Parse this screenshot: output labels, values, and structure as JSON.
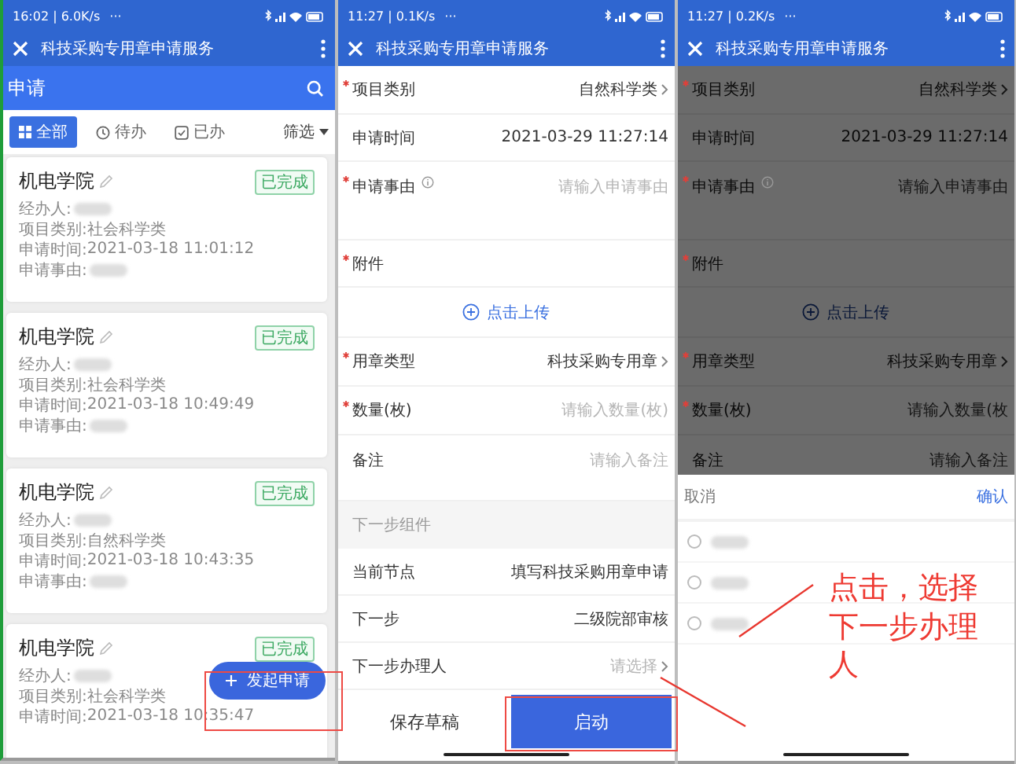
{
  "screens": [
    {
      "kind": "list",
      "status": {
        "time": "16:02 | 6.0K/s",
        "more": "···"
      },
      "title": "科技采购专用章申请服务",
      "search": {
        "value": "申请"
      },
      "filters": [
        {
          "label": "全部",
          "selected": true
        },
        {
          "label": "待办",
          "selected": false
        },
        {
          "label": "已办",
          "selected": false
        }
      ],
      "filter_menu": "筛选",
      "cards": [
        {
          "title": "机电学院",
          "status": "已完成",
          "lines": [
            {
              "label": "经办人:",
              "redacted": true
            },
            {
              "label": "项目类别:",
              "value": "社会科学类"
            },
            {
              "label": "申请时间:",
              "value": "2021-03-18 11:01:12"
            },
            {
              "label": "申请事由:",
              "redacted": true
            }
          ]
        },
        {
          "title": "机电学院",
          "status": "已完成",
          "lines": [
            {
              "label": "经办人:",
              "redacted": true
            },
            {
              "label": "项目类别:",
              "value": "社会科学类"
            },
            {
              "label": "申请时间:",
              "value": "2021-03-18 10:49:49"
            },
            {
              "label": "申请事由:",
              "redacted": true
            }
          ]
        },
        {
          "title": "机电学院",
          "status": "已完成",
          "lines": [
            {
              "label": "经办人:",
              "redacted": true
            },
            {
              "label": "项目类别:",
              "value": "自然科学类"
            },
            {
              "label": "申请时间:",
              "value": "2021-03-18 10:43:35"
            },
            {
              "label": "申请事由:",
              "redacted": true
            }
          ]
        },
        {
          "title": "机电学院",
          "status": "已完成",
          "lines": [
            {
              "label": "经办人:",
              "redacted": true
            },
            {
              "label": "项目类别:",
              "value": "社会科学类"
            },
            {
              "label": "申请时间:",
              "value": "2021-03-18 10:35:47"
            }
          ]
        }
      ],
      "fab": {
        "label": "发起申请"
      }
    },
    {
      "kind": "form",
      "dimmed": false,
      "status": {
        "time": "11:27 | 0.1K/s",
        "more": "···"
      },
      "title": "科技采购专用章申请服务",
      "rows": [
        {
          "kind": "select",
          "label": "项目类别",
          "required": true,
          "value": "自然科学类"
        },
        {
          "kind": "static",
          "label": "申请时间",
          "required": false,
          "value": "2021-03-29 11:27:14"
        },
        {
          "kind": "textarea",
          "label": "申请事由",
          "required": true,
          "info": true,
          "placeholder": "请输入申请事由"
        },
        {
          "kind": "attachment",
          "label": "附件",
          "required": true
        },
        {
          "kind": "upload",
          "label": "点击上传"
        },
        {
          "kind": "select",
          "label": "用章类型",
          "required": true,
          "value": "科技采购专用章"
        },
        {
          "kind": "input",
          "label": "数量(枚)",
          "required": true,
          "placeholder": "请输入数量(枚)"
        },
        {
          "kind": "textarea",
          "label": "备注",
          "required": false,
          "info": false,
          "placeholder": "请输入备注"
        },
        {
          "kind": "section",
          "label": "下一步组件"
        },
        {
          "kind": "static",
          "label": "当前节点",
          "required": false,
          "value": "填写科技采购用章申请"
        },
        {
          "kind": "static",
          "label": "下一步",
          "required": false,
          "value": "二级院部审核"
        },
        {
          "kind": "picker",
          "label": "下一步办理人",
          "required": false,
          "placeholder": "请选择"
        }
      ],
      "footer": {
        "secondary": "保存草稿",
        "primary": "启动"
      }
    },
    {
      "kind": "form",
      "dimmed": true,
      "status": {
        "time": "11:27 | 0.2K/s",
        "more": "···"
      },
      "title": "科技采购专用章申请服务",
      "rows": [
        {
          "kind": "select",
          "label": "项目类别",
          "required": true,
          "value": "自然科学类"
        },
        {
          "kind": "static",
          "label": "申请时间",
          "required": false,
          "value": "2021-03-29 11:27:14"
        },
        {
          "kind": "textarea",
          "label": "申请事由",
          "required": true,
          "info": true,
          "placeholder": "请输入申请事由"
        },
        {
          "kind": "attachment",
          "label": "附件",
          "required": true
        },
        {
          "kind": "upload",
          "label": "点击上传"
        },
        {
          "kind": "select",
          "label": "用章类型",
          "required": true,
          "value": "科技采购专用章"
        },
        {
          "kind": "input",
          "label": "数量(枚)",
          "required": true,
          "placeholder": "请输入数量(枚"
        },
        {
          "kind": "textarea",
          "label": "备注",
          "required": false,
          "info": false,
          "placeholder": "请输入备注"
        }
      ],
      "sheet": {
        "cancel": "取消",
        "confirm": "确认",
        "options": [
          {
            "selected": false
          },
          {
            "selected": false
          },
          {
            "selected": false
          }
        ]
      }
    }
  ],
  "annotation": {
    "text": "点击，选择下一步办理人"
  }
}
